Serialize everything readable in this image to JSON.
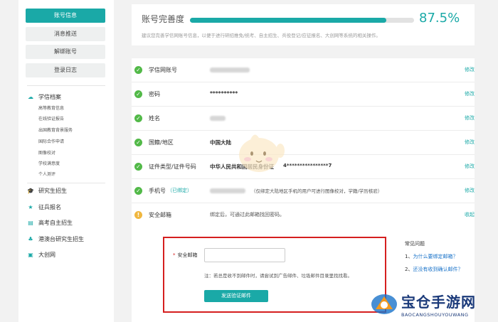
{
  "sidebar": {
    "buttons": [
      {
        "label": "账号信息"
      },
      {
        "label": "消息推送"
      },
      {
        "label": "解绑账号"
      },
      {
        "label": "登录日志"
      }
    ],
    "archive": {
      "label": "学信档案",
      "icon": "cloud-icon",
      "items": [
        "高等教育信息",
        "在线验证报告",
        "出国教育背景服务",
        "国际合作申请",
        "图像校对",
        "学校满意度",
        "个人测评"
      ]
    },
    "sections": [
      {
        "label": "研究生招生",
        "icon": "graduation-cap-icon"
      },
      {
        "label": "征兵报名",
        "icon": "star-icon"
      },
      {
        "label": "高考自主招生",
        "icon": "book-icon"
      },
      {
        "label": "港澳台研究生招生",
        "icon": "people-icon"
      },
      {
        "label": "大创网",
        "icon": "document-icon"
      }
    ]
  },
  "completion": {
    "title": "账号完善度",
    "percent_text": "87.5%",
    "progress": 0.875,
    "hint": "建议您完善学信网账号信息，以便于进行研招推免/统考、自主招生、兵役登记/应征报名、大创网等系统的相关操作。"
  },
  "rows": [
    {
      "label": "学信网账号",
      "value": "",
      "action": "修改",
      "status": "ok"
    },
    {
      "label": "密码",
      "value": "**********",
      "action": "修改",
      "status": "ok"
    },
    {
      "label": "姓名",
      "value": "",
      "action": "修改",
      "status": "ok"
    },
    {
      "label": "国籍/地区",
      "value": "中国大陆",
      "action": "修改",
      "status": "ok"
    },
    {
      "label": "证件类型/证件号码",
      "value": "中华人民共和国居民身份证",
      "value2": "4****************7",
      "action": "修改",
      "status": "ok"
    },
    {
      "label": "手机号",
      "bound": "（已绑定）",
      "note": "（仅绑定大陆地区手机的用户可进行图像校对，学籍/学历核验）",
      "action": "修改",
      "status": "ok"
    },
    {
      "label": "安全邮箱",
      "value": "绑定后，可通过此邮箱找回密码。",
      "action": "收起",
      "status": "warn"
    }
  ],
  "email_form": {
    "label": "安全邮箱",
    "required_mark": "*",
    "input_value": "",
    "input_placeholder": "",
    "note": "注：若总是收不到邮件时，请尝试到广告邮件、垃圾邮件目录里找找看。",
    "button": "发送验证邮件"
  },
  "faq": {
    "title": "常见问题",
    "items": [
      {
        "num": "1、",
        "text": "为什么要绑定邮箱？"
      },
      {
        "num": "2、",
        "text": "还没有收到确认邮件？"
      }
    ]
  },
  "watermark": {
    "title": "宝仓手游网",
    "sub": "BAOCANGSHOUYOUWANG"
  },
  "colors": {
    "accent": "#1aa9a7",
    "ok": "#52b948",
    "warn": "#f0b73f",
    "highlight_border": "#d51f1f",
    "link": "#1a73c9"
  }
}
